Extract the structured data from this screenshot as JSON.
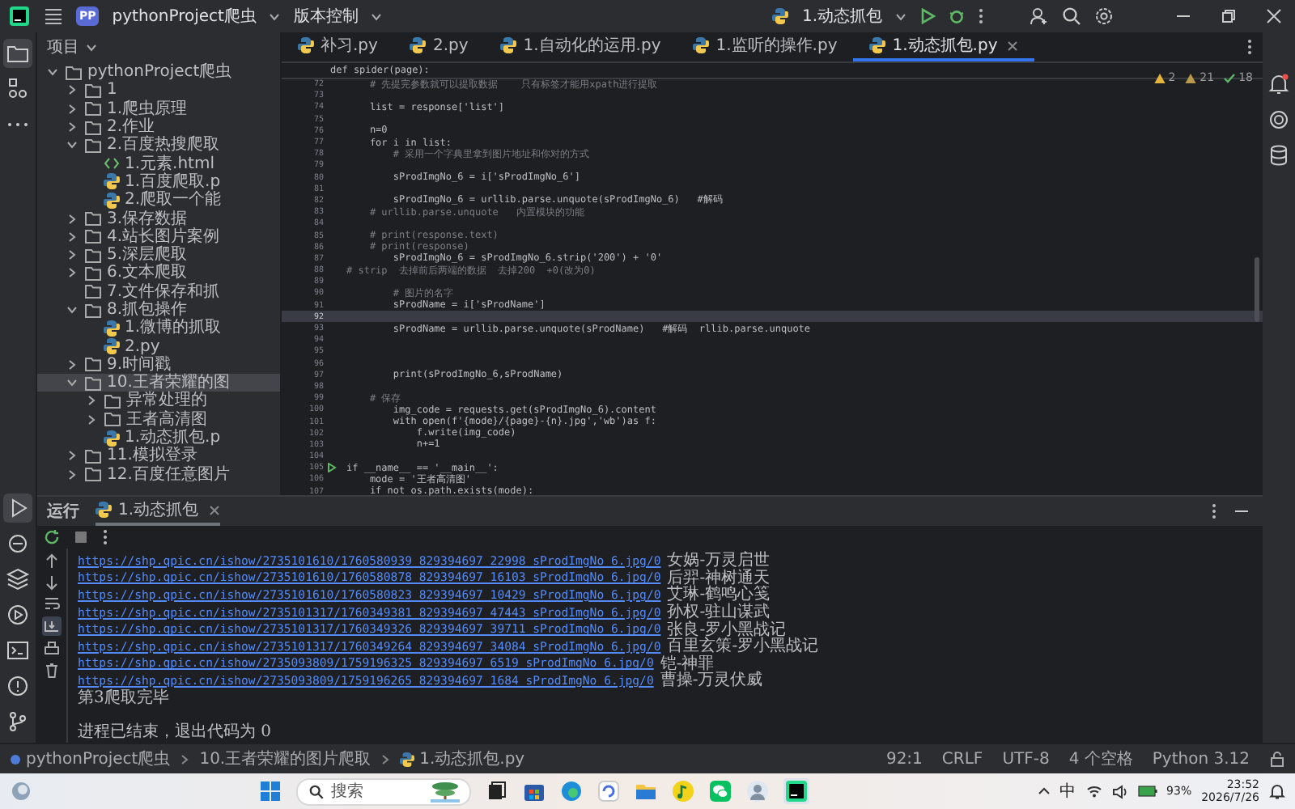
{
  "title_bar": {
    "project_badge": "PP",
    "project": "pythonProject爬虫",
    "vcs": "版本控制",
    "run_config": "1.动态抓包"
  },
  "project_panel": {
    "title": "项目",
    "tree": [
      {
        "label": "pythonProject爬虫",
        "kind": "folder",
        "expanded": true,
        "selected": false,
        "children": [
          {
            "label": "1",
            "kind": "folder",
            "expanded": false,
            "selected": false
          },
          {
            "label": "1.爬虫原理",
            "kind": "folder",
            "expanded": false,
            "selected": false
          },
          {
            "label": "2.作业",
            "kind": "folder",
            "expanded": false,
            "selected": false
          },
          {
            "label": "2.百度热搜爬取",
            "kind": "folder",
            "expanded": true,
            "selected": false,
            "children": [
              {
                "label": "1.元素.html",
                "kind": "html",
                "selected": false
              },
              {
                "label": "1.百度爬取.p",
                "kind": "python",
                "selected": false
              },
              {
                "label": "2.爬取一个能",
                "kind": "python",
                "selected": false
              }
            ]
          },
          {
            "label": "3.保存数据",
            "kind": "folder",
            "expanded": false,
            "selected": false
          },
          {
            "label": "4.站长图片案例",
            "kind": "folder",
            "expanded": false,
            "selected": false
          },
          {
            "label": "5.深层爬取",
            "kind": "folder",
            "expanded": false,
            "selected": false
          },
          {
            "label": "6.文本爬取",
            "kind": "folder",
            "expanded": false,
            "selected": false
          },
          {
            "label": "7.文件保存和抓",
            "kind": "folder",
            "selected": false
          },
          {
            "label": "8.抓包操作",
            "kind": "folder",
            "expanded": true,
            "selected": false,
            "children": [
              {
                "label": "1.微博的抓取",
                "kind": "python",
                "selected": false
              },
              {
                "label": "2.py",
                "kind": "python",
                "selected": false
              }
            ]
          },
          {
            "label": "9.时间戳",
            "kind": "folder",
            "expanded": false,
            "selected": false
          },
          {
            "label": "10.王者荣耀的图",
            "kind": "folder",
            "expanded": true,
            "selected": true,
            "children": [
              {
                "label": "异常处理的",
                "kind": "folder",
                "expanded": false,
                "selected": false
              },
              {
                "label": "王者高清图",
                "kind": "folder",
                "expanded": false,
                "selected": false
              },
              {
                "label": "1.动态抓包.p",
                "kind": "python",
                "selected": false
              }
            ]
          },
          {
            "label": "11.模拟登录",
            "kind": "folder",
            "expanded": false,
            "selected": false
          },
          {
            "label": "12.百度任意图片",
            "kind": "folder",
            "expanded": false,
            "selected": false
          }
        ]
      }
    ]
  },
  "tabs": [
    {
      "label": "补习.py",
      "selected": false
    },
    {
      "label": "2.py",
      "selected": false
    },
    {
      "label": "1.自动化的运用.py",
      "selected": false
    },
    {
      "label": "1.监听的操作.py",
      "selected": false
    },
    {
      "label": "1.动态抓包.py",
      "selected": true
    }
  ],
  "editor": {
    "inspections": [
      {
        "kind": "warning",
        "count": "2"
      },
      {
        "kind": "weak",
        "count": "21"
      },
      {
        "kind": "ok",
        "count": "18"
      }
    ],
    "sticky_header": "def spider(page):",
    "lines": [
      {
        "number": "72",
        "kind": "comment",
        "text": "    # 先提完参数就可以提取数据    只有标签才能用xpath进行提取",
        "current": false
      },
      {
        "number": "73",
        "kind": "blank",
        "current": false
      },
      {
        "number": "74",
        "kind": "code",
        "text": "    list = response['list']",
        "current": false
      },
      {
        "number": "75",
        "kind": "blank",
        "current": false
      },
      {
        "number": "76",
        "kind": "code",
        "text": "    n=0",
        "current": false
      },
      {
        "number": "77",
        "kind": "code",
        "text": "    for i in list:",
        "current": false
      },
      {
        "number": "78",
        "kind": "comment",
        "text": "        # 采用一个字典里拿到图片地址和你对的方式",
        "current": false
      },
      {
        "number": "79",
        "kind": "blank",
        "current": false
      },
      {
        "number": "80",
        "kind": "code",
        "text": "        sProdImgNo_6 = i['sProdImgNo_6']",
        "current": false
      },
      {
        "number": "81",
        "kind": "blank",
        "current": false
      },
      {
        "number": "82",
        "kind": "code",
        "text": "        sProdImgNo_6 = urllib.parse.unquote(sProdImgNo_6)   #解码",
        "current": false
      },
      {
        "number": "83",
        "kind": "comment",
        "text": "    # urllib.parse.unquote   内置模块的功能",
        "current": false
      },
      {
        "number": "84",
        "kind": "blank",
        "current": false
      },
      {
        "number": "85",
        "kind": "comment",
        "text": "    # print(response.text)",
        "current": false
      },
      {
        "number": "86",
        "kind": "comment",
        "text": "    # print(response)",
        "current": false
      },
      {
        "number": "87",
        "kind": "code",
        "text": "        sProdImgNo_6 = sProdImgNo_6.strip('200') + '0'",
        "current": false
      },
      {
        "number": "88",
        "kind": "comment",
        "text": "# strip  去掉前后两端的数据  去掉200  +0(改为0)",
        "current": false
      },
      {
        "number": "89",
        "kind": "blank",
        "current": false
      },
      {
        "number": "90",
        "kind": "comment",
        "text": "        # 图片的名字",
        "current": false
      },
      {
        "number": "91",
        "kind": "code",
        "text": "        sProdName = i['sProdName']",
        "current": false
      },
      {
        "number": "92",
        "kind": "blank",
        "current": true
      },
      {
        "number": "93",
        "kind": "code",
        "text": "        sProdName = urllib.parse.unquote(sProdName)   #解码  rllib.parse.unquote",
        "current": false
      },
      {
        "number": "94",
        "kind": "blank",
        "current": false
      },
      {
        "number": "95",
        "kind": "blank",
        "current": false
      },
      {
        "number": "96",
        "kind": "blank",
        "current": false
      },
      {
        "number": "97",
        "kind": "code",
        "text": "        print(sProdImgNo_6,sProdName)",
        "current": false
      },
      {
        "number": "98",
        "kind": "blank",
        "current": false
      },
      {
        "number": "99",
        "kind": "comment",
        "text": "    # 保存",
        "current": false
      },
      {
        "number": "100",
        "kind": "code",
        "text": "        img_code = requests.get(sProdImgNo_6).content",
        "current": false
      },
      {
        "number": "101",
        "kind": "code",
        "text": "        with open(f'{mode}/{page}-{n}.jpg','wb')as f:",
        "current": false
      },
      {
        "number": "102",
        "kind": "code",
        "text": "            f.write(img_code)",
        "current": false
      },
      {
        "number": "103",
        "kind": "code",
        "text": "            n+=1",
        "current": false
      },
      {
        "number": "104",
        "kind": "blank",
        "current": false
      },
      {
        "number": "105",
        "kind": "code",
        "text": "if __name__ == '__main__':",
        "current": false,
        "run_marker": true
      },
      {
        "number": "106",
        "kind": "code",
        "text": "    mode = '王者高清图'",
        "current": false
      },
      {
        "number": "107",
        "kind": "code",
        "text": "    if not os.path.exists(mode):",
        "current": false
      }
    ]
  },
  "run_panel": {
    "title": "运行",
    "tab": "1.动态抓包",
    "output": [
      {
        "kind": "link",
        "url": "https://shp.qpic.cn/ishow/2735101610/1760580939_829394697_22998_sProdImgNo_6.jpg/0",
        "name": "女娲-万灵启世"
      },
      {
        "kind": "link",
        "url": "https://shp.qpic.cn/ishow/2735101610/1760580878_829394697_16103_sProdImgNo_6.jpg/0",
        "name": "后羿-神树通天"
      },
      {
        "kind": "link",
        "url": "https://shp.qpic.cn/ishow/2735101610/1760580823_829394697_10429_sProdImgNo_6.jpg/0",
        "name": "艾琳-鹤鸣心笺"
      },
      {
        "kind": "link",
        "url": "https://shp.qpic.cn/ishow/2735101317/1760349381_829394697_47443_sProdImgNo_6.jpg/0",
        "name": "孙权-驻山谋武"
      },
      {
        "kind": "link",
        "url": "https://shp.qpic.cn/ishow/2735101317/1760349326_829394697_39711_sProdImgNo_6.jpg/0",
        "name": "张良-罗小黑战记"
      },
      {
        "kind": "link",
        "url": "https://shp.qpic.cn/ishow/2735101317/1760349264_829394697_34084_sProdImgNo_6.jpg/0",
        "name": "百里玄策-罗小黑战记"
      },
      {
        "kind": "link",
        "url": "https://shp.qpic.cn/ishow/2735093809/1759196325_829394697_6519_sProdImgNo_6.jpg/0",
        "name": "铠-神罪"
      },
      {
        "kind": "link",
        "url": "https://shp.qpic.cn/ishow/2735093809/1759196265_829394697_1684_sProdImgNo_6.jpg/0",
        "name": "曹操-万灵伏威"
      },
      {
        "kind": "text",
        "text": "第3爬取完毕"
      },
      {
        "kind": "blank"
      },
      {
        "kind": "text",
        "text": "进程已结束，退出代码为 0"
      }
    ]
  },
  "status_bar": {
    "breadcrumbs": [
      {
        "kind": "module",
        "label": "pythonProject爬虫"
      },
      {
        "kind": "folder",
        "label": "10.王者荣耀的图片爬取"
      },
      {
        "kind": "python",
        "label": "1.动态抓包.py"
      }
    ],
    "items": [
      "92:1",
      "CRLF",
      "UTF-8",
      "4 个空格",
      "Python 3.12"
    ]
  },
  "taskbar": {
    "search_placeholder": "搜索",
    "tray": {
      "ime": "中",
      "battery": "93%",
      "time": "23:52",
      "date": "2026/7/26"
    }
  }
}
